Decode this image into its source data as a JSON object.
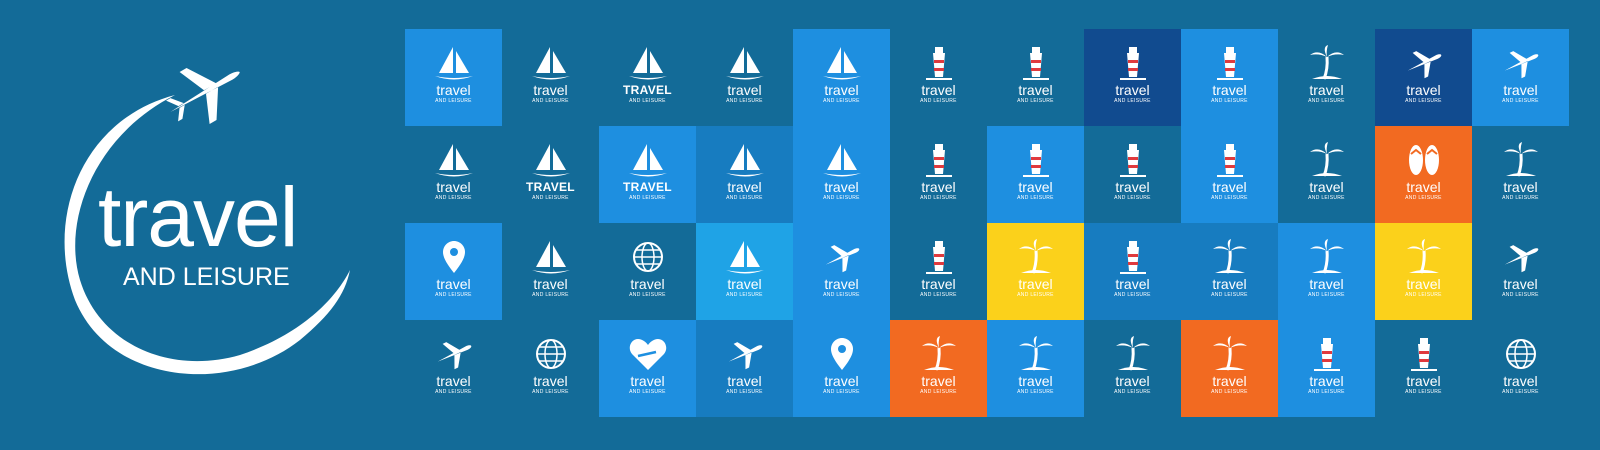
{
  "hero": {
    "title": "travel",
    "subtitle": "AND LEISURE",
    "icon": "airplane-icon"
  },
  "colors": {
    "background": "#136b98",
    "light_blue": "#1e8fe0",
    "sky_blue": "#1fa3e6",
    "mid_blue": "#177cc0",
    "navy": "#114b8f",
    "orange": "#f26a21",
    "yellow": "#fbd11b",
    "white": "#ffffff"
  },
  "tiles": [
    {
      "title": "travel",
      "sub": "AND LEISURE",
      "icon": "sailboat-icon",
      "bg": "#1e8fe0",
      "caps": false
    },
    {
      "title": "travel",
      "sub": "AND LEISURE",
      "icon": "sailboat-icon",
      "bg": "",
      "caps": false
    },
    {
      "title": "TRAVEL",
      "sub": "AND LEISURE",
      "icon": "sailboat-icon",
      "bg": "",
      "caps": true
    },
    {
      "title": "travel",
      "sub": "AND LEISURE",
      "icon": "sailboat-icon",
      "bg": "",
      "caps": false
    },
    {
      "title": "travel",
      "sub": "AND LEISURE",
      "icon": "sailboat-icon",
      "bg": "#1e8fe0",
      "caps": false
    },
    {
      "title": "travel",
      "sub": "AND LEISURE",
      "icon": "lighthouse-icon",
      "bg": "",
      "caps": false
    },
    {
      "title": "travel",
      "sub": "AND LEISURE",
      "icon": "lighthouse-icon",
      "bg": "",
      "caps": false
    },
    {
      "title": "travel",
      "sub": "AND LEISURE",
      "icon": "lighthouse-icon",
      "bg": "#114b8f",
      "caps": false
    },
    {
      "title": "travel",
      "sub": "AND LEISURE",
      "icon": "lighthouse-icon",
      "bg": "#1e8fe0",
      "caps": false
    },
    {
      "title": "travel",
      "sub": "AND LEISURE",
      "icon": "palm-tree-icon",
      "bg": "",
      "caps": false
    },
    {
      "title": "travel",
      "sub": "AND LEISURE",
      "icon": "airplane-icon",
      "bg": "#114b8f",
      "caps": false
    },
    {
      "title": "travel",
      "sub": "AND LEISURE",
      "icon": "airplane-icon",
      "bg": "#1e8fe0",
      "caps": false
    },
    {
      "title": "travel",
      "sub": "AND LEISURE",
      "icon": "sailboat-icon",
      "bg": "",
      "caps": false
    },
    {
      "title": "TRAVEL",
      "sub": "AND LEISURE",
      "icon": "sailboat-icon",
      "bg": "",
      "caps": true
    },
    {
      "title": "TRAVEL",
      "sub": "AND LEISURE",
      "icon": "sailboat-icon",
      "bg": "#1e8fe0",
      "caps": true
    },
    {
      "title": "travel",
      "sub": "AND LEISURE",
      "icon": "sailboat-icon",
      "bg": "#177cc0",
      "caps": false
    },
    {
      "title": "travel",
      "sub": "AND LEISURE",
      "icon": "sailboat-icon",
      "bg": "#1e8fe0",
      "caps": false
    },
    {
      "title": "travel",
      "sub": "AND LEISURE",
      "icon": "lighthouse-icon",
      "bg": "",
      "caps": false
    },
    {
      "title": "travel",
      "sub": "AND LEISURE",
      "icon": "lighthouse-icon",
      "bg": "#1e8fe0",
      "caps": false
    },
    {
      "title": "travel",
      "sub": "AND LEISURE",
      "icon": "lighthouse-icon",
      "bg": "",
      "caps": false
    },
    {
      "title": "travel",
      "sub": "AND LEISURE",
      "icon": "lighthouse-icon",
      "bg": "#1e8fe0",
      "caps": false
    },
    {
      "title": "travel",
      "sub": "AND LEISURE",
      "icon": "palm-tree-icon",
      "bg": "",
      "caps": false
    },
    {
      "title": "travel",
      "sub": "AND LEISURE",
      "icon": "flip-flops-icon",
      "bg": "#f26a21",
      "caps": false
    },
    {
      "title": "travel",
      "sub": "AND LEISURE",
      "icon": "palm-tree-icon",
      "bg": "",
      "caps": false
    },
    {
      "title": "travel",
      "sub": "AND LEISURE",
      "icon": "map-pin-icon",
      "bg": "#1e8fe0",
      "caps": false
    },
    {
      "title": "travel",
      "sub": "AND LEISURE",
      "icon": "sailboat-icon",
      "bg": "",
      "caps": false
    },
    {
      "title": "travel",
      "sub": "AND LEISURE",
      "icon": "globe-icon",
      "bg": "",
      "caps": false
    },
    {
      "title": "travel",
      "sub": "AND LEISURE",
      "icon": "sailboat-icon",
      "bg": "#1fa3e6",
      "caps": false
    },
    {
      "title": "travel",
      "sub": "AND LEISURE",
      "icon": "airplane-icon",
      "bg": "#1e8fe0",
      "caps": false
    },
    {
      "title": "travel",
      "sub": "AND LEISURE",
      "icon": "lighthouse-icon",
      "bg": "",
      "caps": false
    },
    {
      "title": "travel",
      "sub": "AND LEISURE",
      "icon": "palm-tree-icon",
      "bg": "#fbd11b",
      "caps": false
    },
    {
      "title": "travel",
      "sub": "AND LEISURE",
      "icon": "lighthouse-icon",
      "bg": "#177cc0",
      "caps": false
    },
    {
      "title": "travel",
      "sub": "AND LEISURE",
      "icon": "palm-tree-icon",
      "bg": "#177cc0",
      "caps": false
    },
    {
      "title": "travel",
      "sub": "AND LEISURE",
      "icon": "palm-tree-icon",
      "bg": "#1e8fe0",
      "caps": false
    },
    {
      "title": "travel",
      "sub": "AND LEISURE",
      "icon": "palm-tree-icon",
      "bg": "#fbd11b",
      "caps": false
    },
    {
      "title": "travel",
      "sub": "AND LEISURE",
      "icon": "airplane-icon",
      "bg": "",
      "caps": false
    },
    {
      "title": "travel",
      "sub": "AND LEISURE",
      "icon": "airplane-icon",
      "bg": "",
      "caps": false
    },
    {
      "title": "travel",
      "sub": "AND LEISURE",
      "icon": "globe-icon",
      "bg": "",
      "caps": false
    },
    {
      "title": "travel",
      "sub": "AND LEISURE",
      "icon": "heart-icon",
      "bg": "#1e8fe0",
      "caps": false
    },
    {
      "title": "travel",
      "sub": "AND LEISURE",
      "icon": "airplane-icon",
      "bg": "#177cc0",
      "caps": false
    },
    {
      "title": "travel",
      "sub": "AND LEISURE",
      "icon": "map-pin-icon",
      "bg": "#1e8fe0",
      "caps": false
    },
    {
      "title": "travel",
      "sub": "AND LEISURE",
      "icon": "palm-tree-icon",
      "bg": "#f26a21",
      "caps": false
    },
    {
      "title": "travel",
      "sub": "AND LEISURE",
      "icon": "palm-tree-icon",
      "bg": "#1e8fe0",
      "caps": false
    },
    {
      "title": "travel",
      "sub": "AND LEISURE",
      "icon": "palm-tree-icon",
      "bg": "",
      "caps": false
    },
    {
      "title": "travel",
      "sub": "AND LEISURE",
      "icon": "palm-tree-icon",
      "bg": "#f26a21",
      "caps": false
    },
    {
      "title": "travel",
      "sub": "AND LEISURE",
      "icon": "lighthouse-icon",
      "bg": "#1e8fe0",
      "caps": false
    },
    {
      "title": "travel",
      "sub": "AND LEISURE",
      "icon": "lighthouse-icon",
      "bg": "",
      "caps": false
    },
    {
      "title": "travel",
      "sub": "AND LEISURE",
      "icon": "globe-icon",
      "bg": "",
      "caps": false
    }
  ]
}
